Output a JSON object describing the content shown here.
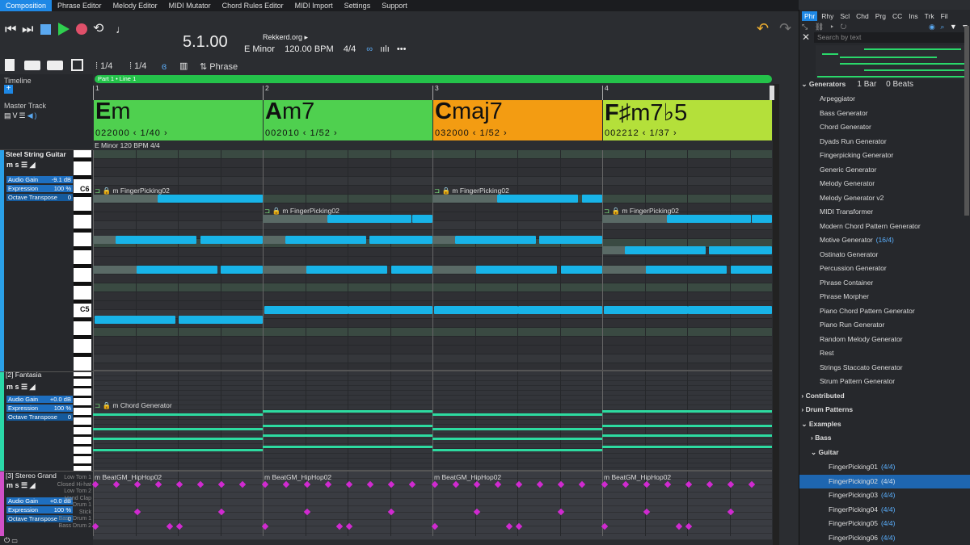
{
  "menu": [
    "Composition",
    "Phrase Editor",
    "Melody Editor",
    "MIDI Mutator",
    "Chord Rules Editor",
    "MIDI Import",
    "Settings",
    "Support"
  ],
  "transport": {
    "version": "5.1.00",
    "site": "Rekkerd.org",
    "key": "E Minor",
    "bpm": "120.00 BPM",
    "meter": "4/4"
  },
  "toolbar": {
    "snap1": "1/4",
    "snap2": "1/4",
    "mode": "Phrase"
  },
  "left": {
    "timeline": "Timeline",
    "master": "Master Track",
    "tracks": [
      {
        "name": "Steel String Guitar",
        "gain_label": "Audio Gain",
        "gain": "-9.1 dB",
        "expr_label": "Expression",
        "expr": "100 %",
        "oct_label": "Octave Transpose",
        "oct": "0"
      },
      {
        "name": "[2] Fantasia",
        "gain_label": "Audio Gain",
        "gain": "+0.0 dB",
        "expr_label": "Expression",
        "expr": "100 %",
        "oct_label": "Octave Transpose",
        "oct": "0"
      },
      {
        "name": "[3] Stereo Grand",
        "gain_label": "Audio Gain",
        "gain": "+0.0 dB",
        "expr_label": "Expression",
        "expr": "100 %",
        "oct_label": "Octave Transpose",
        "oct": "0"
      }
    ],
    "keys": {
      "c6": "C6",
      "c5": "C5"
    },
    "drums": [
      "Low Tom 1",
      "Closed Hi-hat",
      "Low Tom 2",
      "Hand Clap",
      "Drum 1",
      "Stick",
      "Bass Drum 1",
      "Bass Drum 2"
    ]
  },
  "timeline": {
    "part": "Part 1 • Line 1",
    "bars": [
      "1",
      "2",
      "3",
      "4"
    ]
  },
  "chords": [
    {
      "root": "E",
      "rest": "m",
      "frets": "022000",
      "index": "1/40",
      "color": "#4fd04f"
    },
    {
      "root": "A",
      "rest": "m7",
      "frets": "002010",
      "index": "1/52",
      "color": "#4fd04f"
    },
    {
      "root": "C",
      "rest": "maj7",
      "frets": "032000",
      "index": "1/52",
      "color": "#f39c12"
    },
    {
      "root": "F",
      "rest": "♯m7♭5",
      "frets": "002212",
      "index": "1/37",
      "color": "#b4e03a"
    }
  ],
  "keyline": "E Minor  120 BPM  4/4",
  "phrases": {
    "guitar": "FingerPicking02",
    "fantasia": "Chord Generator",
    "drums": "BeatGM_HipHop02"
  },
  "right": {
    "tabs": [
      "Phr",
      "Rhy",
      "Scl",
      "Chd",
      "Prg",
      "CC",
      "Ins",
      "Trk",
      "Fil"
    ],
    "search_placeholder": "Search by text",
    "gen_header": "Generators",
    "gen_bars": "1 Bar",
    "gen_beats": "0 Beats",
    "generators": [
      "Arpeggiator",
      "Bass Generator",
      "Chord Generator",
      "Dyads Run Generator",
      "Fingerpicking Generator",
      "Generic Generator",
      "Melody Generator",
      "Melody Generator v2",
      "MIDI Transformer",
      "Modern Chord Pattern Generator",
      "Motive Generator",
      "Ostinato Generator",
      "Percussion Generator",
      "Phrase Container",
      "Phrase Morpher",
      "Piano Chord Pattern Generator",
      "Piano Run Generator",
      "Random Melody Generator",
      "Rest",
      "Strings Staccato Generator",
      "Strum Pattern Generator"
    ],
    "motive_count": "(16/4)",
    "contributed": "Contributed",
    "drum_patterns": "Drum Patterns",
    "examples": "Examples",
    "bass": "Bass",
    "guitar": "Guitar",
    "finger": [
      {
        "name": "FingerPicking01",
        "cnt": "(4/4)"
      },
      {
        "name": "FingerPicking02",
        "cnt": "(4/4)"
      },
      {
        "name": "FingerPicking03",
        "cnt": "(4/4)"
      },
      {
        "name": "FingerPicking04",
        "cnt": "(4/4)"
      },
      {
        "name": "FingerPicking05",
        "cnt": "(4/4)"
      },
      {
        "name": "FingerPicking06",
        "cnt": "(4/4)"
      }
    ]
  }
}
